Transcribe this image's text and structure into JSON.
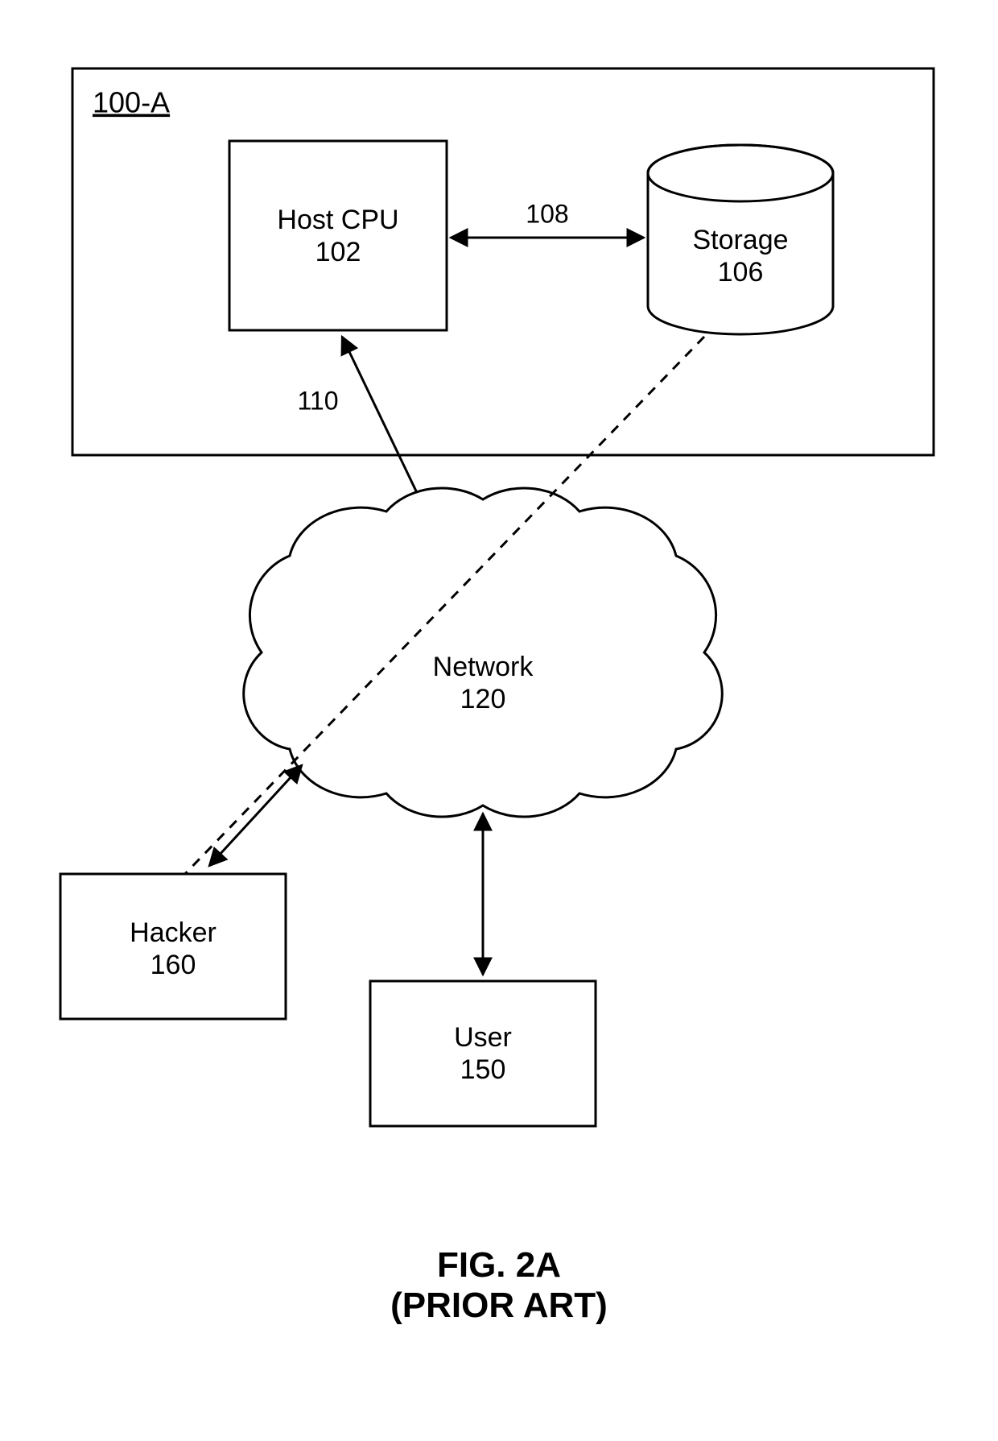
{
  "system": {
    "id_label": "100-A",
    "host_cpu": {
      "title": "Host CPU",
      "ref": "102"
    },
    "storage": {
      "title": "Storage",
      "ref": "106"
    },
    "link_cpu_storage_ref": "108",
    "link_cpu_network_ref": "110"
  },
  "network": {
    "title": "Network",
    "ref": "120"
  },
  "hacker": {
    "title": "Hacker",
    "ref": "160"
  },
  "user": {
    "title": "User",
    "ref": "150"
  },
  "caption": {
    "line1": "FIG. 2A",
    "line2": "(PRIOR ART)"
  }
}
